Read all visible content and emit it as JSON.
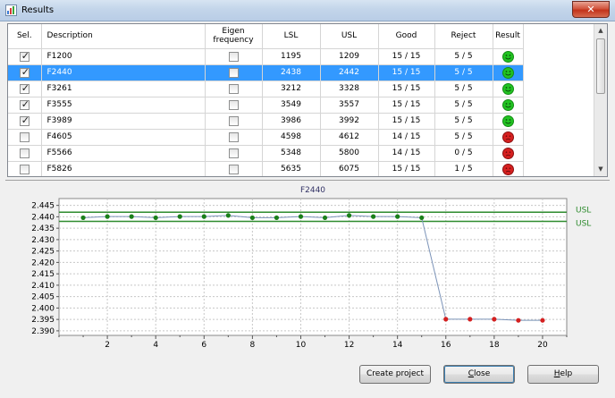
{
  "window": {
    "title": "Results",
    "close_glyph": "✕"
  },
  "grid": {
    "columns": [
      "Sel.",
      "Description",
      "Eigen frequency",
      "LSL",
      "USL",
      "Good",
      "Reject",
      "Result"
    ],
    "rows": [
      {
        "sel": true,
        "desc": "F1200",
        "eigen": false,
        "lsl": "1195",
        "usl": "1209",
        "good": "15 / 15",
        "reject": "5 / 5",
        "result": "pass"
      },
      {
        "sel": true,
        "desc": "F2440",
        "eigen": false,
        "lsl": "2438",
        "usl": "2442",
        "good": "15 / 15",
        "reject": "5 / 5",
        "result": "pass",
        "selected": true
      },
      {
        "sel": true,
        "desc": "F3261",
        "eigen": false,
        "lsl": "3212",
        "usl": "3328",
        "good": "15 / 15",
        "reject": "5 / 5",
        "result": "pass"
      },
      {
        "sel": true,
        "desc": "F3555",
        "eigen": false,
        "lsl": "3549",
        "usl": "3557",
        "good": "15 / 15",
        "reject": "5 / 5",
        "result": "pass"
      },
      {
        "sel": true,
        "desc": "F3989",
        "eigen": false,
        "lsl": "3986",
        "usl": "3992",
        "good": "15 / 15",
        "reject": "5 / 5",
        "result": "pass"
      },
      {
        "sel": false,
        "desc": "F4605",
        "eigen": false,
        "lsl": "4598",
        "usl": "4612",
        "good": "14 / 15",
        "reject": "5 / 5",
        "result": "fail"
      },
      {
        "sel": false,
        "desc": "F5566",
        "eigen": false,
        "lsl": "5348",
        "usl": "5800",
        "good": "14 / 15",
        "reject": "0 / 5",
        "result": "fail"
      },
      {
        "sel": false,
        "desc": "F5826",
        "eigen": false,
        "lsl": "5635",
        "usl": "6075",
        "good": "15 / 15",
        "reject": "1 / 5",
        "result": "fail"
      }
    ]
  },
  "chart_data": {
    "type": "scatter",
    "title": "F2440",
    "xlim": [
      0,
      21
    ],
    "ylim": [
      2.388,
      2.448
    ],
    "x_ticks": [
      2,
      4,
      6,
      8,
      10,
      12,
      14,
      16,
      18,
      20
    ],
    "y_ticks": [
      "2.445",
      "2.440",
      "2.435",
      "2.430",
      "2.425",
      "2.420",
      "2.415",
      "2.410",
      "2.405",
      "2.400",
      "2.395",
      "2.390"
    ],
    "grid": true,
    "limits": [
      {
        "label": "USL",
        "value": 2.442,
        "color": "#2e8b2e"
      },
      {
        "label": "USL",
        "value": 2.438,
        "color": "#2e8b2e"
      }
    ],
    "series": [
      {
        "color": "#1a7f1a",
        "x": [
          1,
          2,
          3,
          4,
          5,
          6,
          7,
          8,
          9,
          10,
          11,
          12,
          13,
          14,
          15
        ],
        "y": [
          2.4396,
          2.4401,
          2.4401,
          2.4396,
          2.4401,
          2.4401,
          2.4406,
          2.4396,
          2.4396,
          2.4401,
          2.4396,
          2.4406,
          2.4401,
          2.4401,
          2.4396
        ]
      },
      {
        "color": "#d42020",
        "x": [
          16,
          17,
          18,
          19,
          20
        ],
        "y": [
          2.3951,
          2.3951,
          2.3951,
          2.3946,
          2.3946
        ]
      }
    ],
    "line_color": "#7b93b8"
  },
  "buttons": {
    "create": "Create project",
    "close": "Close",
    "help": "Help"
  },
  "colors": {
    "pass": "#22c422",
    "fail": "#d62020",
    "selection": "#3399ff"
  }
}
